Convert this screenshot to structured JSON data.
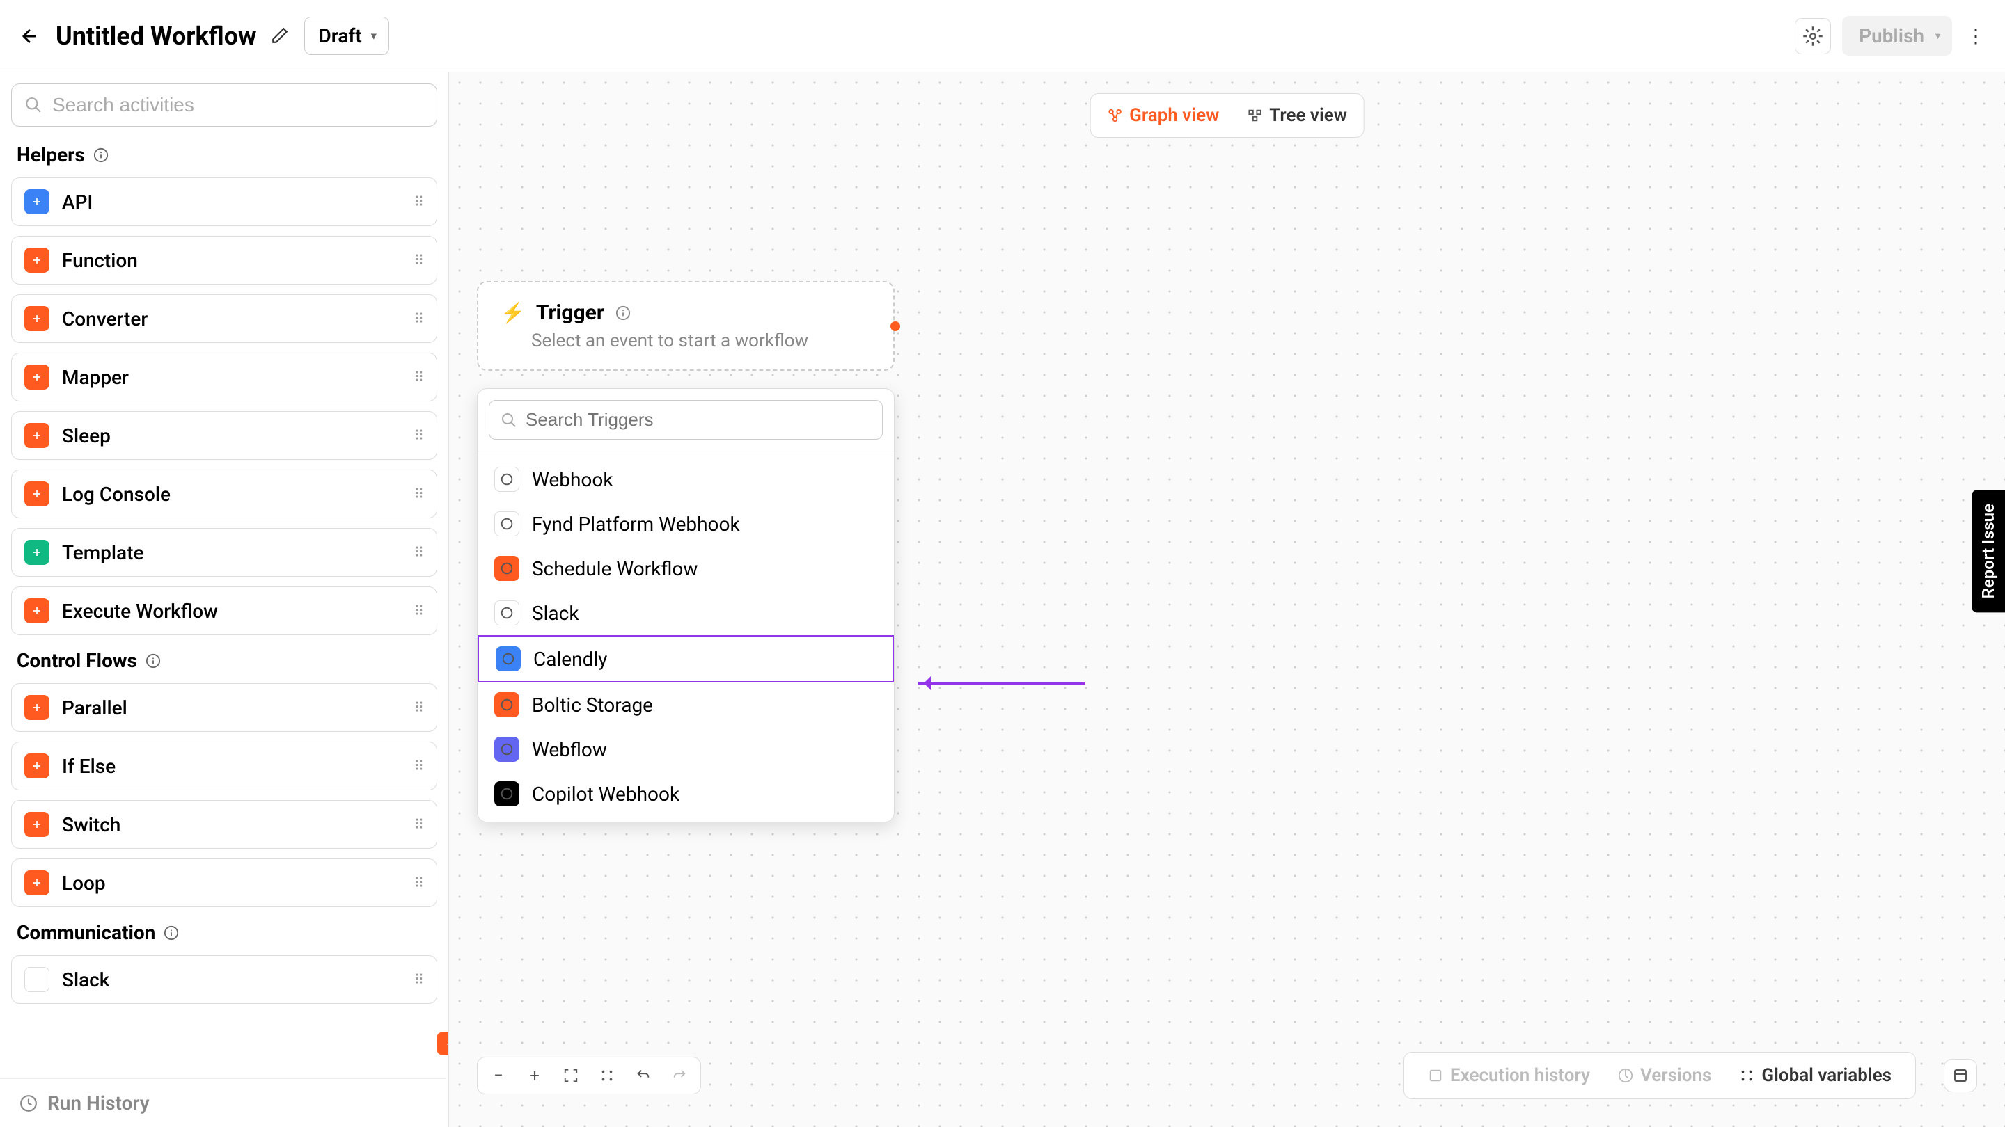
{
  "header": {
    "title": "Untitled Workflow",
    "status": "Draft",
    "publish": "Publish"
  },
  "sidebar": {
    "search_placeholder": "Search activities",
    "sections": {
      "helpers": "Helpers",
      "control_flows": "Control Flows",
      "communication": "Communication"
    },
    "helpers": [
      {
        "label": "API",
        "bg": "ic-blue"
      },
      {
        "label": "Function",
        "bg": "ic-orange"
      },
      {
        "label": "Converter",
        "bg": "ic-orange"
      },
      {
        "label": "Mapper",
        "bg": "ic-orange"
      },
      {
        "label": "Sleep",
        "bg": "ic-orange"
      },
      {
        "label": "Log Console",
        "bg": "ic-orange"
      },
      {
        "label": "Template",
        "bg": "ic-green"
      },
      {
        "label": "Execute Workflow",
        "bg": "ic-orange"
      }
    ],
    "control_flows": [
      {
        "label": "Parallel",
        "bg": "ic-orange"
      },
      {
        "label": "If Else",
        "bg": "ic-orange"
      },
      {
        "label": "Switch",
        "bg": "ic-orange"
      },
      {
        "label": "Loop",
        "bg": "ic-orange"
      }
    ],
    "communication": [
      {
        "label": "Slack",
        "bg": "ic-slack"
      }
    ],
    "run_history": "Run History"
  },
  "canvas": {
    "view_graph": "Graph view",
    "view_tree": "Tree view",
    "trigger": {
      "title": "Trigger",
      "subtitle": "Select an event to start a workflow"
    },
    "trigger_search_placeholder": "Search Triggers",
    "triggers": [
      {
        "label": "Webhook",
        "bg": "ic-webhook",
        "highlight": false
      },
      {
        "label": "Fynd Platform Webhook",
        "bg": "ic-webhook",
        "highlight": false
      },
      {
        "label": "Schedule Workflow",
        "bg": "ic-orange",
        "highlight": false
      },
      {
        "label": "Slack",
        "bg": "ic-slack",
        "highlight": false
      },
      {
        "label": "Calendly",
        "bg": "ic-blue",
        "highlight": true
      },
      {
        "label": "Boltic Storage",
        "bg": "ic-orange",
        "highlight": false
      },
      {
        "label": "Webflow",
        "bg": "ic-purple",
        "highlight": false
      },
      {
        "label": "Copilot Webhook",
        "bg": "ic-copilot",
        "highlight": false
      }
    ]
  },
  "bottom": {
    "exec_history": "Execution history",
    "versions": "Versions",
    "global_vars": "Global variables"
  },
  "report_issue": "Report Issue"
}
